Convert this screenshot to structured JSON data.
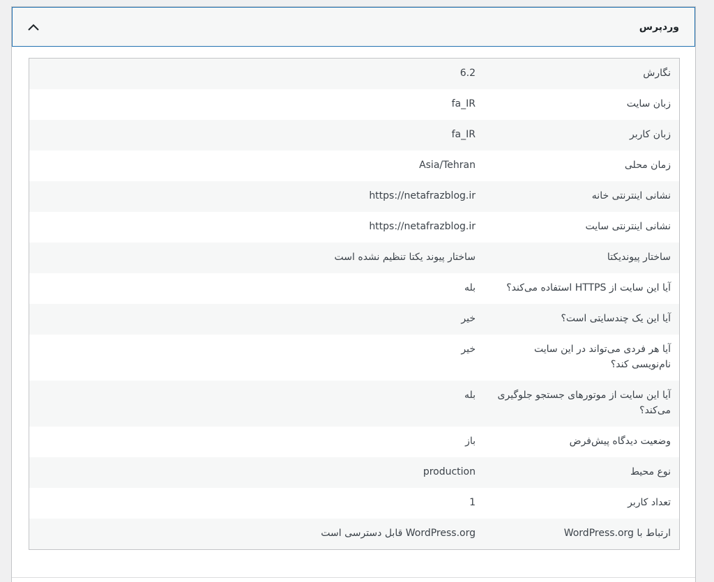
{
  "section": {
    "title": "وردپرس",
    "toggle_icon": "chevron-up-icon"
  },
  "rows": [
    {
      "label": "نگارش",
      "value": "6.2"
    },
    {
      "label": "زبان سایت",
      "value": "fa_IR"
    },
    {
      "label": "زبان کاربر",
      "value": "fa_IR"
    },
    {
      "label": "زمان محلی",
      "value": "Asia/Tehran"
    },
    {
      "label": "نشانی اینترنتی خانه",
      "value": "https://netafrazblog.ir"
    },
    {
      "label": "نشانی اینترنتی سایت",
      "value": "https://netafrazblog.ir"
    },
    {
      "label": "ساختار پیوندیکتا",
      "value": "ساختار پیوند یکتا تنظیم نشده است"
    },
    {
      "label": "آیا این سایت از HTTPS استفاده می‌کند؟",
      "value": "بله"
    },
    {
      "label": "آیا این یک چندسایتی است؟",
      "value": "خیر"
    },
    {
      "label": "آیا هر فردی می‌تواند در این سایت نام‌نویسی کند؟",
      "value": "خیر"
    },
    {
      "label": "آیا این سایت از موتورهای جستجو جلوگیری می‌کند؟",
      "value": "بله"
    },
    {
      "label": "وضعیت دیدگاه پیش‌فرض",
      "value": "باز"
    },
    {
      "label": "نوع محیط",
      "value": "production"
    },
    {
      "label": "تعداد کاربر",
      "value": "1"
    },
    {
      "label": "ارتباط با WordPress.org",
      "value": "WordPress.org قابل دسترسی است"
    }
  ]
}
